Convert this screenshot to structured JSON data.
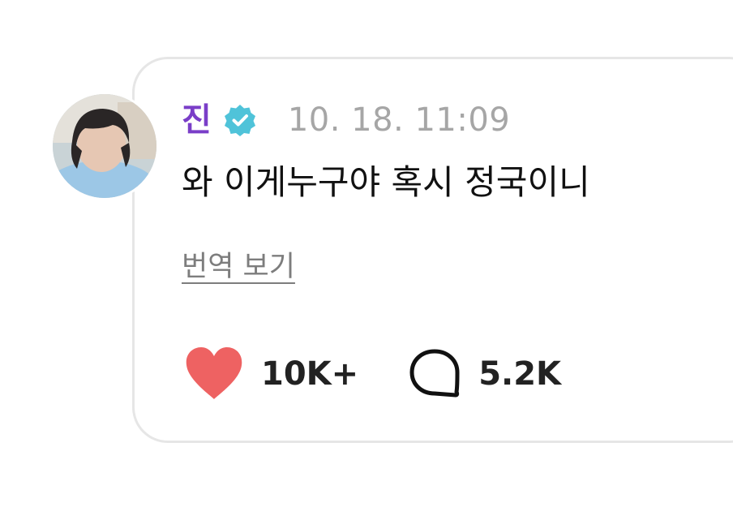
{
  "post": {
    "author": "진",
    "verified_icon": "verified-badge-icon",
    "timestamp": "10. 18. 11:09",
    "message": "와 이게누구야 혹시 정국이니",
    "translate_label": "번역 보기"
  },
  "actions": {
    "like_icon": "heart-icon",
    "like_count": "10K+",
    "comment_icon": "speech-bubble-icon",
    "comment_count": "5.2K"
  },
  "colors": {
    "author": "#7a3ec8",
    "verified_badge": "#4fc3d9",
    "heart": "#ee6262",
    "timestamp": "#a6a6a6",
    "card_border": "#e6e6e6"
  }
}
